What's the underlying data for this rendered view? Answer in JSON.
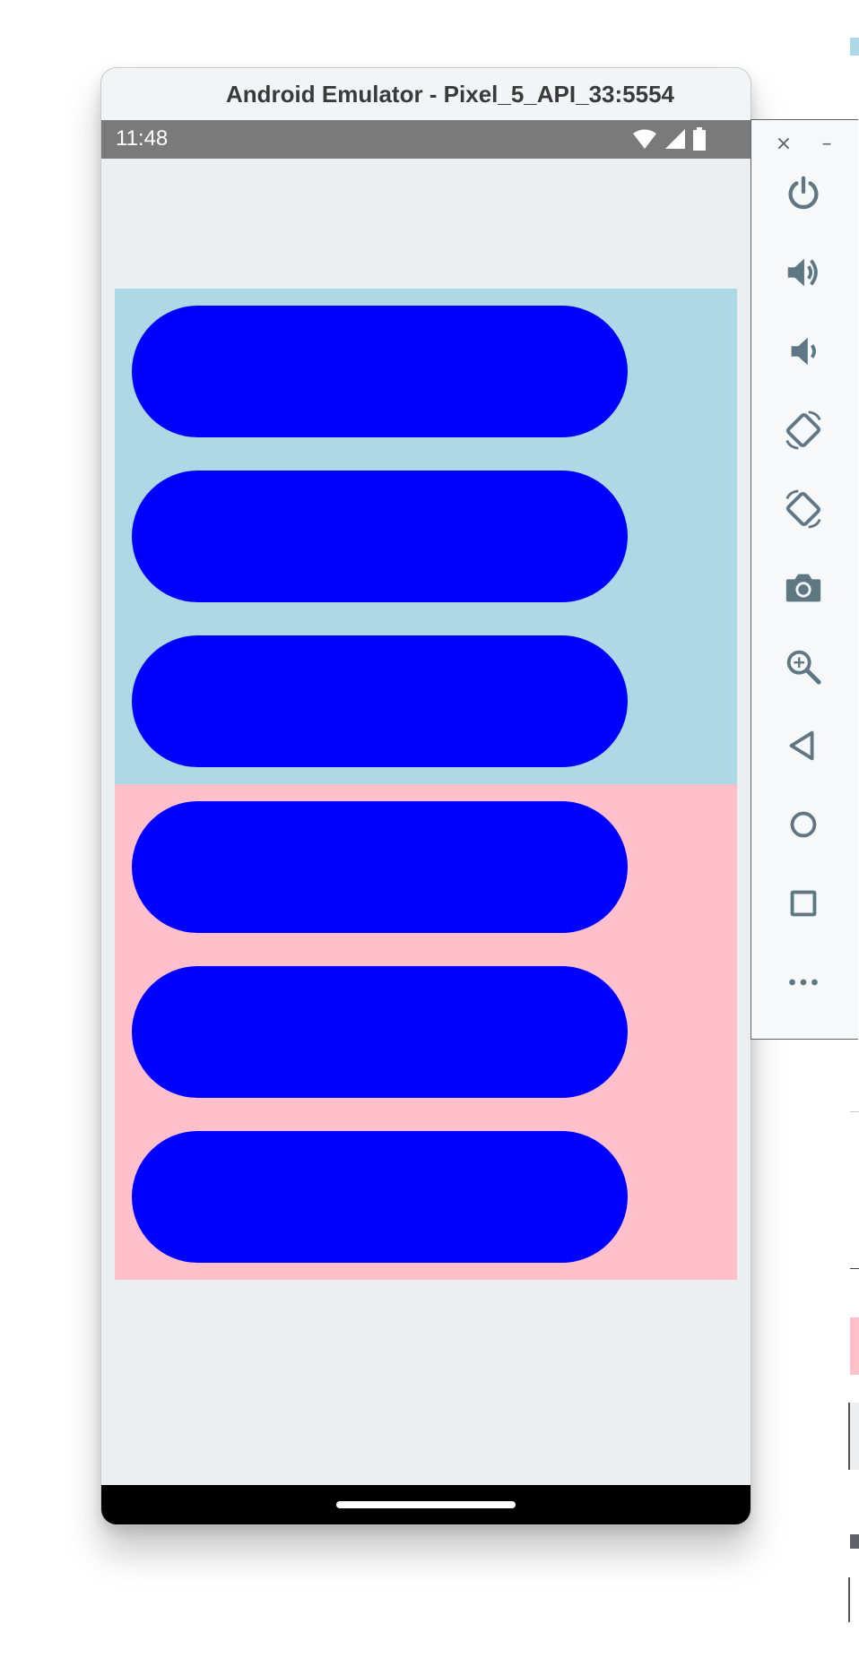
{
  "emulator": {
    "title": "Android Emulator - Pixel_5_API_33:5554"
  },
  "status_bar": {
    "time": "11:48",
    "icons": [
      "wifi-icon",
      "cell-signal-icon",
      "battery-icon"
    ]
  },
  "sections": [
    {
      "name": "blue-section",
      "background": "#add8e6",
      "pills": [
        {
          "color": "#0000ff"
        },
        {
          "color": "#0000ff"
        },
        {
          "color": "#0000ff"
        }
      ]
    },
    {
      "name": "pink-section",
      "background": "#ffc0cb",
      "pills": [
        {
          "color": "#0000ff"
        },
        {
          "color": "#0000ff"
        },
        {
          "color": "#0000ff"
        }
      ]
    }
  ],
  "toolbar": {
    "close_glyph": "×",
    "minimize_glyph": "–",
    "icon_color": "#5f7683",
    "buttons": [
      "power-icon",
      "volume-up-icon",
      "volume-down-icon",
      "rotate-left-icon",
      "rotate-right-icon",
      "camera-icon",
      "zoom-icon",
      "back-icon",
      "home-icon",
      "overview-icon",
      "more-icon"
    ]
  },
  "colors": {
    "screen_background": "#eceff1",
    "status_bar": "#7a7a7a",
    "nav_bar": "#000000",
    "background_strip_cyan": "#add8e6",
    "background_strip_pink": "#ffc0cb"
  }
}
